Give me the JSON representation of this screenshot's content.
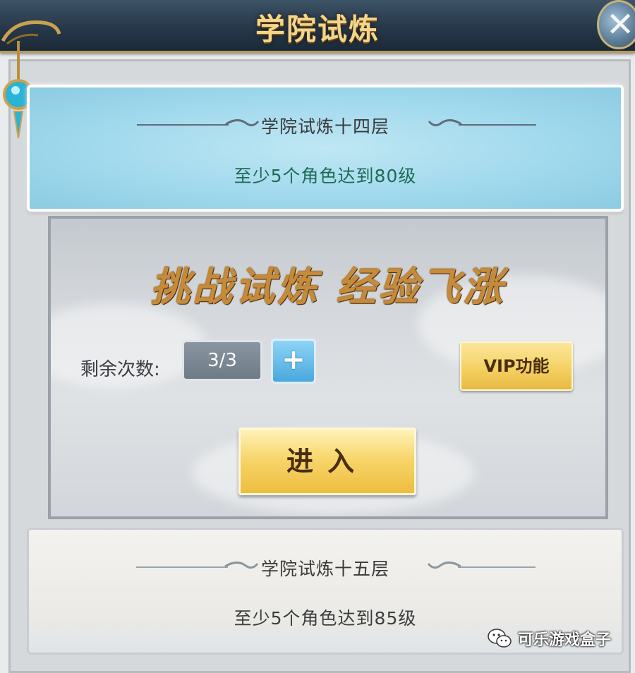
{
  "window": {
    "title": "学院试炼",
    "close_icon": "close-icon"
  },
  "current_level": {
    "name": "学院试炼十四层",
    "requirement": "至少5个角色达到80级"
  },
  "challenge": {
    "slogan": "挑战试炼 经验飞涨",
    "remaining_label": "剩余次数:",
    "remaining_value": "3/3",
    "add_icon": "plus-icon",
    "vip_label": "VIP功能",
    "enter_label": "进入"
  },
  "next_level": {
    "name": "学院试炼十五层",
    "requirement": "至少5个角色达到85级"
  },
  "watermark": {
    "text": "可乐游戏盒子",
    "icon": "wechat-icon"
  },
  "colors": {
    "title_gold": "#f3d68a",
    "selected_card": "#9fd8ec",
    "requirement_green": "#1f6a55",
    "button_gold": "#f3cf5e",
    "plus_blue": "#4aa8dd"
  }
}
